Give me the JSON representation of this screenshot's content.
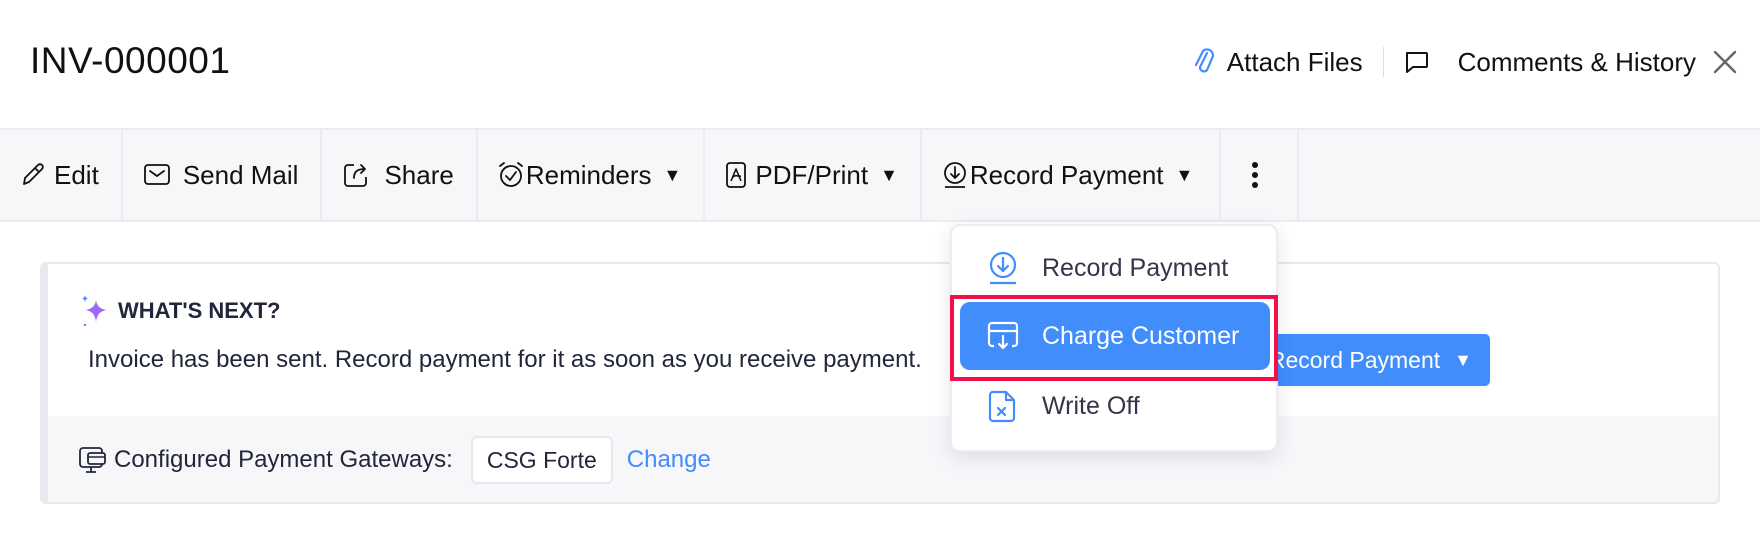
{
  "header": {
    "title": "INV-000001",
    "attach_files_label": "Attach Files",
    "comments_history_label": "Comments & History"
  },
  "toolbar": {
    "items": [
      {
        "label": "Edit",
        "icon": "pencil-icon",
        "has_caret": false
      },
      {
        "label": "Send Mail",
        "icon": "mail-icon",
        "has_caret": false
      },
      {
        "label": "Share",
        "icon": "share-icon",
        "has_caret": false
      },
      {
        "label": "Reminders",
        "icon": "alarm-clock-icon",
        "has_caret": true
      },
      {
        "label": "PDF/Print",
        "icon": "pdf-icon",
        "has_caret": true
      },
      {
        "label": "Record Payment",
        "icon": "download-circle-icon",
        "has_caret": true
      }
    ],
    "caret_glyph": "▼",
    "more_icon": "vertical-ellipsis-icon"
  },
  "whats_next": {
    "title": "WHAT'S NEXT?",
    "message": "Invoice has been sent. Record payment for it as soon as you receive payment.",
    "record_payment_button_label": "Record Payment"
  },
  "gateways": {
    "label": "Configured Payment Gateways:",
    "gateway_name": "CSG Forte",
    "change_label": "Change"
  },
  "record_payment_menu": {
    "items": [
      {
        "label": "Record Payment",
        "icon": "download-circle-icon",
        "selected": false
      },
      {
        "label": "Charge Customer",
        "icon": "card-download-icon",
        "selected": true
      },
      {
        "label": "Write Off",
        "icon": "file-x-icon",
        "selected": false
      }
    ]
  },
  "colors": {
    "accent": "#408dfb",
    "highlight_border": "#f0104c",
    "sparkle": "#9b6bf7"
  }
}
